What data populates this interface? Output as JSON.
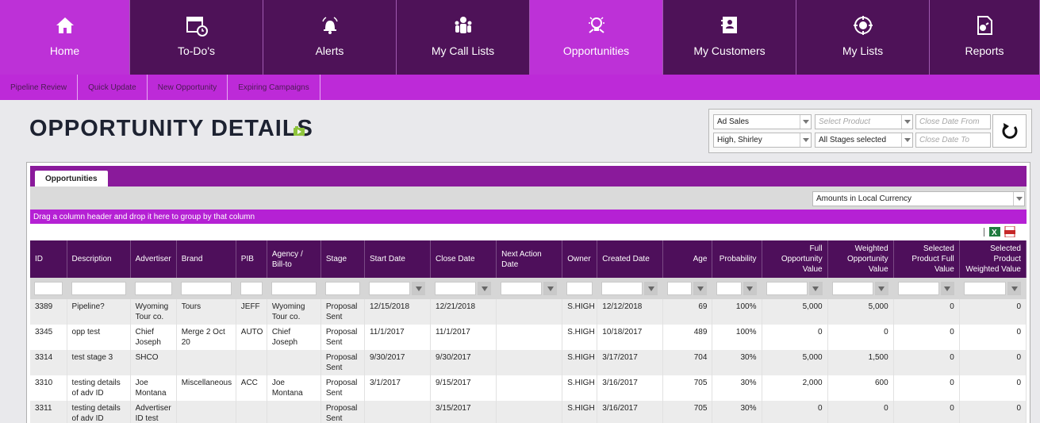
{
  "nav": [
    {
      "label": "Home",
      "icon": "home-icon",
      "active": true
    },
    {
      "label": "To-Do's",
      "icon": "calendar-clock-icon",
      "active": false
    },
    {
      "label": "Alerts",
      "icon": "bell-icon",
      "active": false
    },
    {
      "label": "My Call Lists",
      "icon": "people-icon",
      "active": false
    },
    {
      "label": "Opportunities",
      "icon": "lightbulb-icon",
      "active": true
    },
    {
      "label": "My Customers",
      "icon": "contact-book-icon",
      "active": false
    },
    {
      "label": "My Lists",
      "icon": "target-icon",
      "active": false
    },
    {
      "label": "Reports",
      "icon": "report-icon",
      "active": false
    }
  ],
  "subnav": [
    "Pipeline Review",
    "Quick Update",
    "New Opportunity",
    "Expiring Campaigns"
  ],
  "page": {
    "title": "OPPORTUNITY DETAILS"
  },
  "filters": {
    "department": "Ad Sales",
    "product_placeholder": "Select Product",
    "close_from_placeholder": "Close Date From",
    "owner": "High, Shirley",
    "stages": "All Stages selected",
    "close_to_placeholder": "Close Date To"
  },
  "grid": {
    "tab": "Opportunities",
    "currency": "Amounts in Local Currency",
    "group_hint": "Drag a column header and drop it here to group by that column",
    "columns": [
      "ID",
      "Description",
      "Advertiser",
      "Brand",
      "PIB",
      "Agency / Bill-to",
      "Stage",
      "Start Date",
      "Close Date",
      "Next Action Date",
      "Owner",
      "Created Date",
      "Age",
      "Probability",
      "Full Opportunity Value",
      "Weighted Opportunity Value",
      "Selected Product Full Value",
      "Selected Product Weighted Value"
    ],
    "rows": [
      [
        "3389",
        "Pipeline?",
        "Wyoming Tour co.",
        "Tours",
        "JEFF",
        "Wyoming Tour co.",
        "Proposal Sent",
        "12/15/2018",
        "12/21/2018",
        "",
        "S.HIGH",
        "12/12/2018",
        "69",
        "100%",
        "5,000",
        "5,000",
        "0",
        "0"
      ],
      [
        "3345",
        "opp test",
        "Chief Joseph",
        "Merge 2 Oct 20",
        "AUTO",
        "Chief Joseph",
        "Proposal Sent",
        "11/1/2017",
        "11/1/2017",
        "",
        "S.HIGH",
        "10/18/2017",
        "489",
        "100%",
        "0",
        "0",
        "0",
        "0"
      ],
      [
        "3314",
        "test stage 3",
        "SHCO",
        "",
        "",
        "",
        "Proposal Sent",
        "9/30/2017",
        "9/30/2017",
        "",
        "S.HIGH",
        "3/17/2017",
        "704",
        "30%",
        "5,000",
        "1,500",
        "0",
        "0"
      ],
      [
        "3310",
        "testing details of adv ID",
        "Joe Montana",
        "Miscellaneous",
        "ACC",
        "Joe Montana",
        "Proposal Sent",
        "3/1/2017",
        "9/15/2017",
        "",
        "S.HIGH",
        "3/16/2017",
        "705",
        "30%",
        "2,000",
        "600",
        "0",
        "0"
      ],
      [
        "3311",
        "testing details of adv ID",
        "Advertiser ID test",
        "",
        "",
        "",
        "Proposal Sent",
        "",
        "3/15/2017",
        "",
        "S.HIGH",
        "3/16/2017",
        "705",
        "30%",
        "0",
        "0",
        "0",
        "0"
      ]
    ]
  },
  "colors": {
    "nav_dark": "#4e1258",
    "nav_active": "#bd31d7",
    "link": "#a81fbf"
  }
}
